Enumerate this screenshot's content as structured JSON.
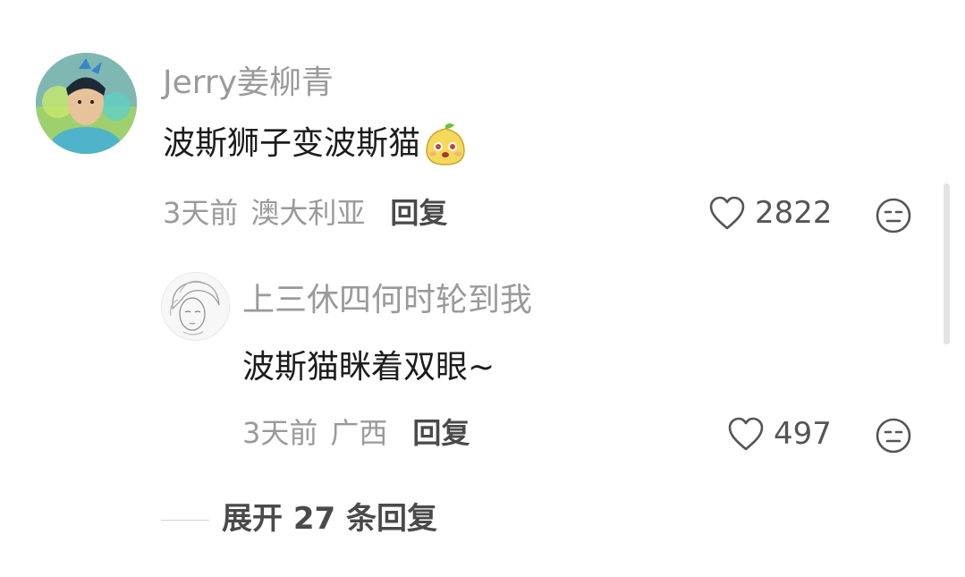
{
  "comment": {
    "username": "Jerry姜柳青",
    "text": "波斯狮子变波斯猫",
    "emoji_icon": "pear-emoji-icon",
    "time": "3天前",
    "location": "澳大利亚",
    "reply_label": "回复",
    "like_count": "2822"
  },
  "reply": {
    "username": "上三休四何时轮到我",
    "text": "波斯猫眯着双眼~",
    "time": "3天前",
    "location": "广西",
    "reply_label": "回复",
    "like_count": "497"
  },
  "expand_label": "展开 27 条回复",
  "colors": {
    "muted_text": "#9a9a9a",
    "body_text": "#1c1c1c",
    "action_text": "#4a4a4a"
  }
}
